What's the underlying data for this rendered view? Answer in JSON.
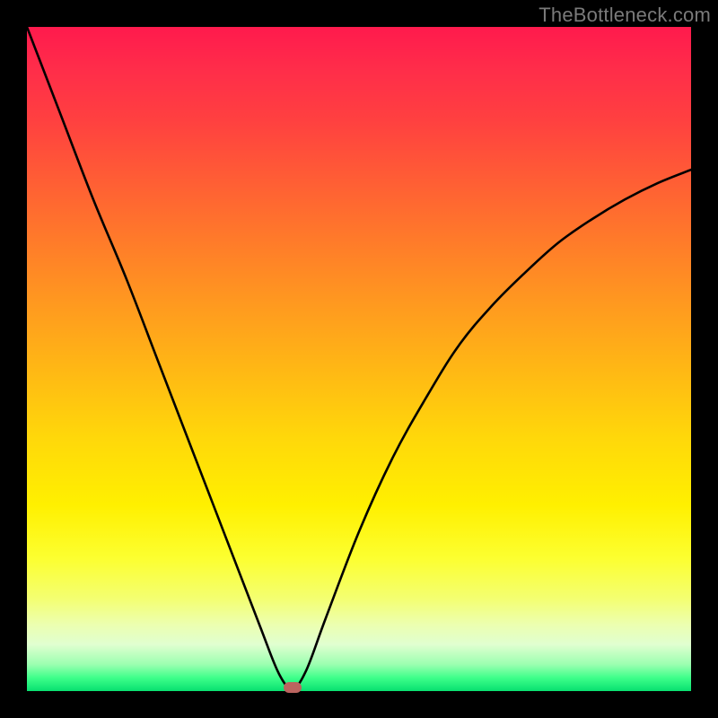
{
  "watermark": "TheBottleneck.com",
  "colors": {
    "background": "#000000",
    "curve": "#000000",
    "marker": "#bb645f"
  },
  "chart_data": {
    "type": "line",
    "title": "",
    "xlabel": "",
    "ylabel": "",
    "xlim": [
      0,
      100
    ],
    "ylim": [
      0,
      100
    ],
    "grid": false,
    "legend": false,
    "series": [
      {
        "name": "bottleneck-curve",
        "x": [
          0,
          5,
          10,
          15,
          20,
          25,
          30,
          35,
          38,
          40,
          42,
          45,
          50,
          55,
          60,
          65,
          70,
          75,
          80,
          85,
          90,
          95,
          100
        ],
        "y": [
          100,
          87,
          74,
          62,
          49,
          36,
          23,
          10,
          2.5,
          0.5,
          3,
          11,
          24,
          35,
          44,
          52,
          58,
          63,
          67.5,
          71,
          74,
          76.5,
          78.5
        ]
      }
    ],
    "marks": [
      {
        "name": "optimal-point",
        "x": 40,
        "y": 0.5
      }
    ]
  }
}
